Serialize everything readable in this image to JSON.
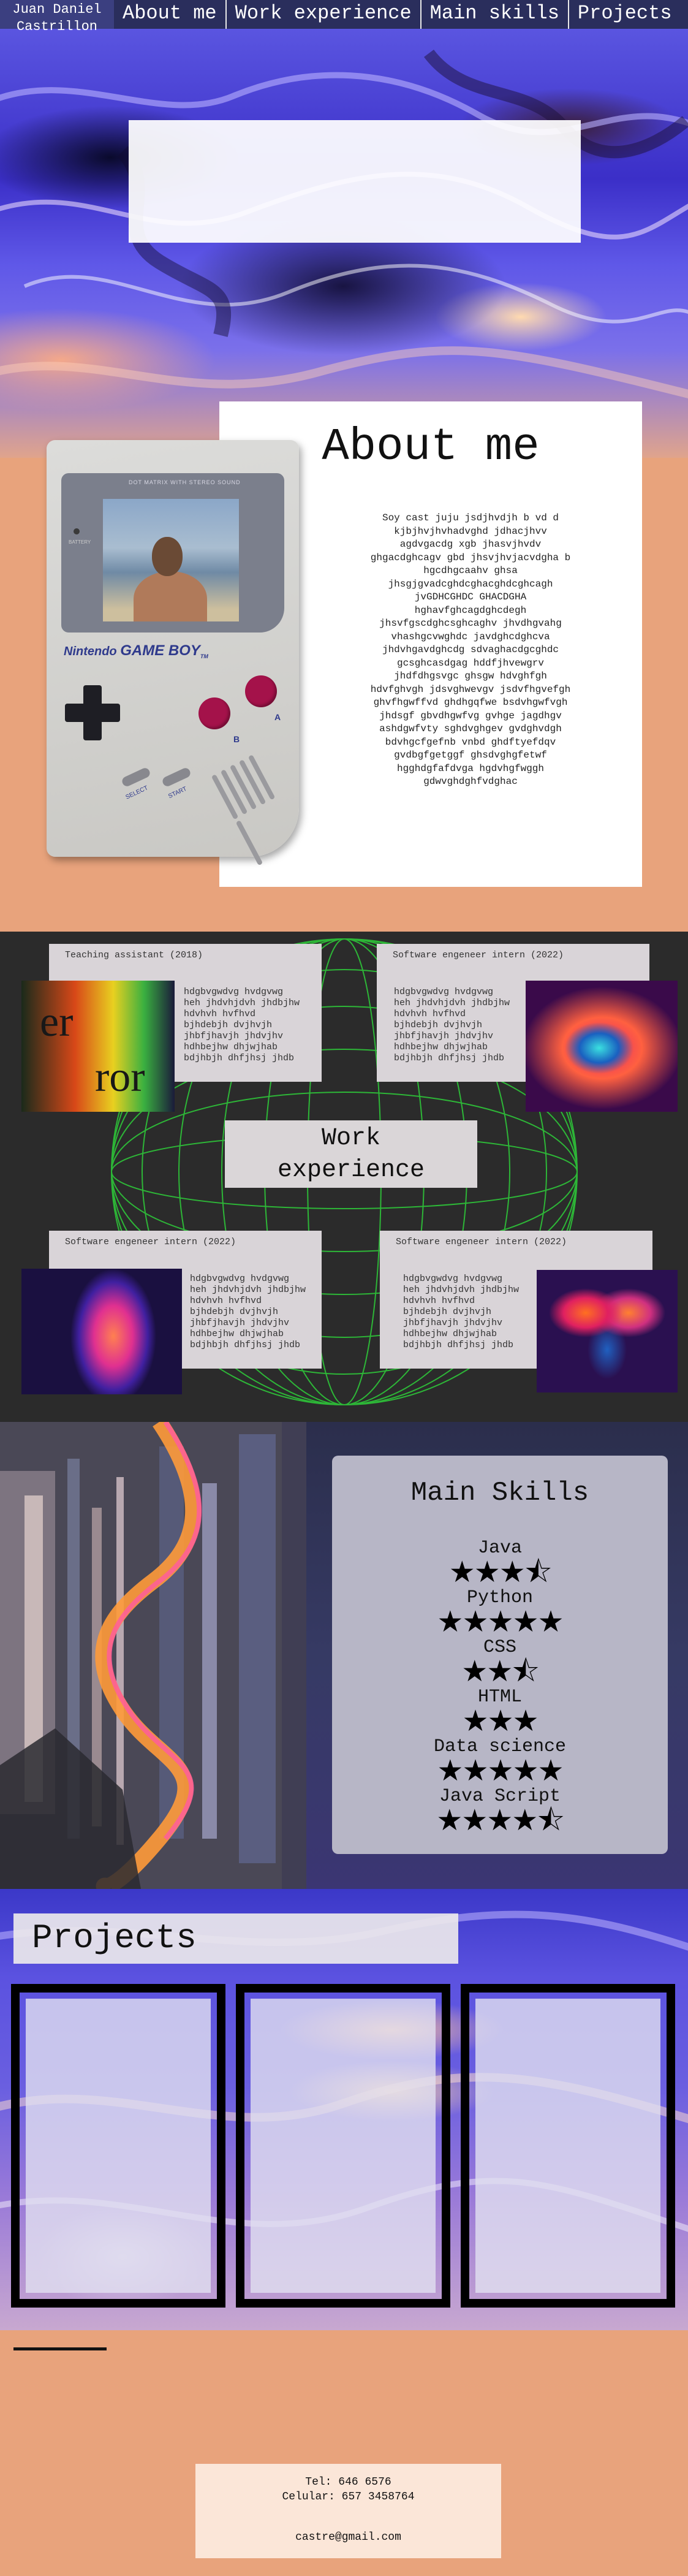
{
  "nav": {
    "brand_line1": "Juan Daniel",
    "brand_line2": "Castrillon",
    "items": [
      "About me",
      "Work experience",
      "Main skills",
      "Projects"
    ]
  },
  "about": {
    "title": "About me",
    "text_lines": [
      "Soy cast juju jsdjhvdjh b vd d",
      "kjbjhvjhvhadvghd jdhacjhvv",
      "agdvgacdg xgb jhasvjhvdv",
      "ghgacdghcagv gbd jhsvjhvjacvdgha b",
      "hgcdhgcaahv ghsa",
      "jhsgjgvadcghdcghacghdcghcagh",
      "jvGDHCGHDC GHACDGHA",
      "hghavfghcagdghcdegh",
      "jhsvfgscdghcsghcaghv jhvdhgvahg",
      "vhashgcvwghdc javdghcdghcva",
      "jhdvhgavdghcdg sdvaghacdgcghdc",
      "gcsghcasdgag hddfjhvewgrv",
      "jhdfdhgsvgc ghsgw hdvghfgh",
      "hdvfghvgh jdsvghwevgv jsdvfhgvefgh",
      "ghvfhgwffvd ghdhgqfwe bsdvhgwfvgh",
      "jhdsgf gbvdhgwfvg gvhge jagdhgv",
      "ashdgwfvty sghdvghgev gvdghvdgh",
      "bdvhgcfgefnb vnbd ghdftyefdqv",
      "gvdbgfgetggf ghsdvghgfetwf",
      "hgghdgfafdvga hgdvhgfwggh",
      "gdwvghdghfvdghac"
    ]
  },
  "gameboy": {
    "bezel_label": "DOT MATRIX WITH STEREO SOUND",
    "battery_label": "BATTERY",
    "brand": "Nintendo",
    "model": "GAME BOY",
    "tm": "TM",
    "btn_b": "B",
    "btn_a": "A",
    "select": "SELECT",
    "start": "START"
  },
  "work": {
    "title_line1": "Work",
    "title_line2": "experience",
    "body_lines": [
      "hdgbvgwdvg hvdgvwg",
      "heh jhdvhjdvh jhdbjhw",
      "hdvhvh hvfhvd",
      "bjhdebjh dvjhvjh",
      "jhbfjhavjh jhdvjhv",
      "hdhbejhw dhjwjhab",
      "bdjhbjh dhfjhsj jhdb"
    ],
    "cards": [
      {
        "title": "Teaching assistant (2018)"
      },
      {
        "title": "Software engeneer intern (2022)"
      },
      {
        "title": "Software engeneer intern (2022)"
      },
      {
        "title": "Software engeneer intern (2022)"
      }
    ]
  },
  "skills": {
    "title": "Main Skills",
    "items": [
      {
        "name": "Java",
        "stars": "★★★⯪"
      },
      {
        "name": "Python",
        "stars": "★★★★★"
      },
      {
        "name": "CSS",
        "stars": "★★⯪"
      },
      {
        "name": "HTML",
        "stars": "★★★"
      },
      {
        "name": "Data science",
        "stars": "★★★★★"
      },
      {
        "name": "Java Script",
        "stars": "★★★★⯪"
      }
    ],
    "ratings": [
      3.5,
      5,
      2.5,
      3,
      5,
      4.5
    ]
  },
  "projects": {
    "title": "Projects"
  },
  "contact": {
    "phone": "Tel: 646 6576",
    "cell": "Celular: 657 3458764",
    "email": "castre@gmail.com"
  }
}
